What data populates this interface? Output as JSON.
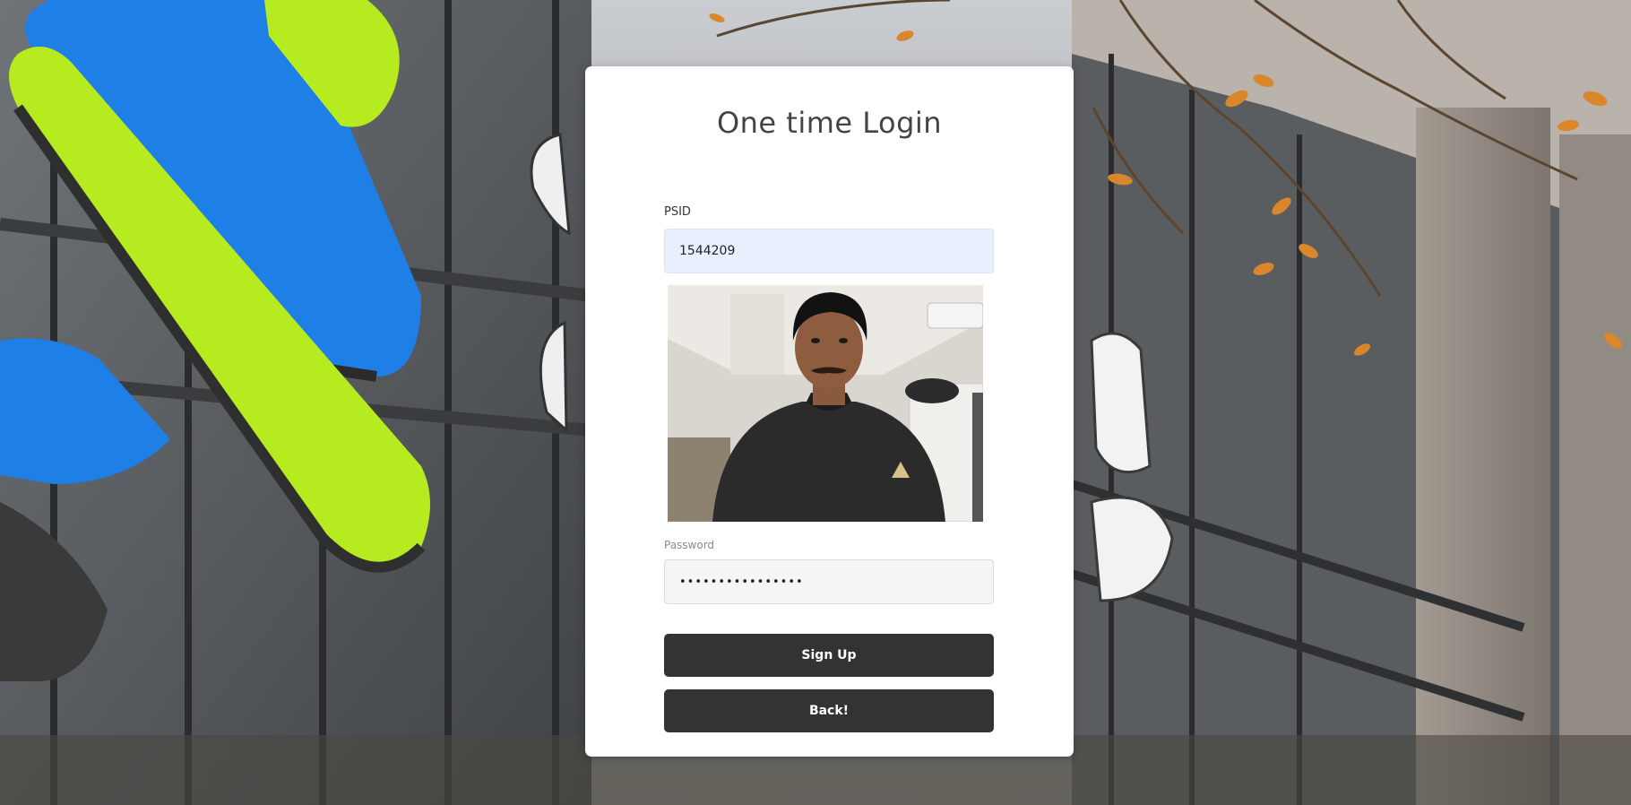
{
  "login": {
    "title": "One time Login",
    "psid_label": "PSID",
    "psid_value": "1544209",
    "webcam_label": "Webcam capture",
    "password_label": "Password",
    "password_value": "••••••••••••••••",
    "signup_label": "Sign Up",
    "back_label": "Back!"
  },
  "colors": {
    "card_bg": "#ffffff",
    "button_bg": "#333333",
    "psid_field_bg": "#e8f0fe",
    "password_field_bg": "#f5f5f5",
    "logo_blue": "#1e7fe6",
    "logo_green": "#b6ec1f"
  }
}
